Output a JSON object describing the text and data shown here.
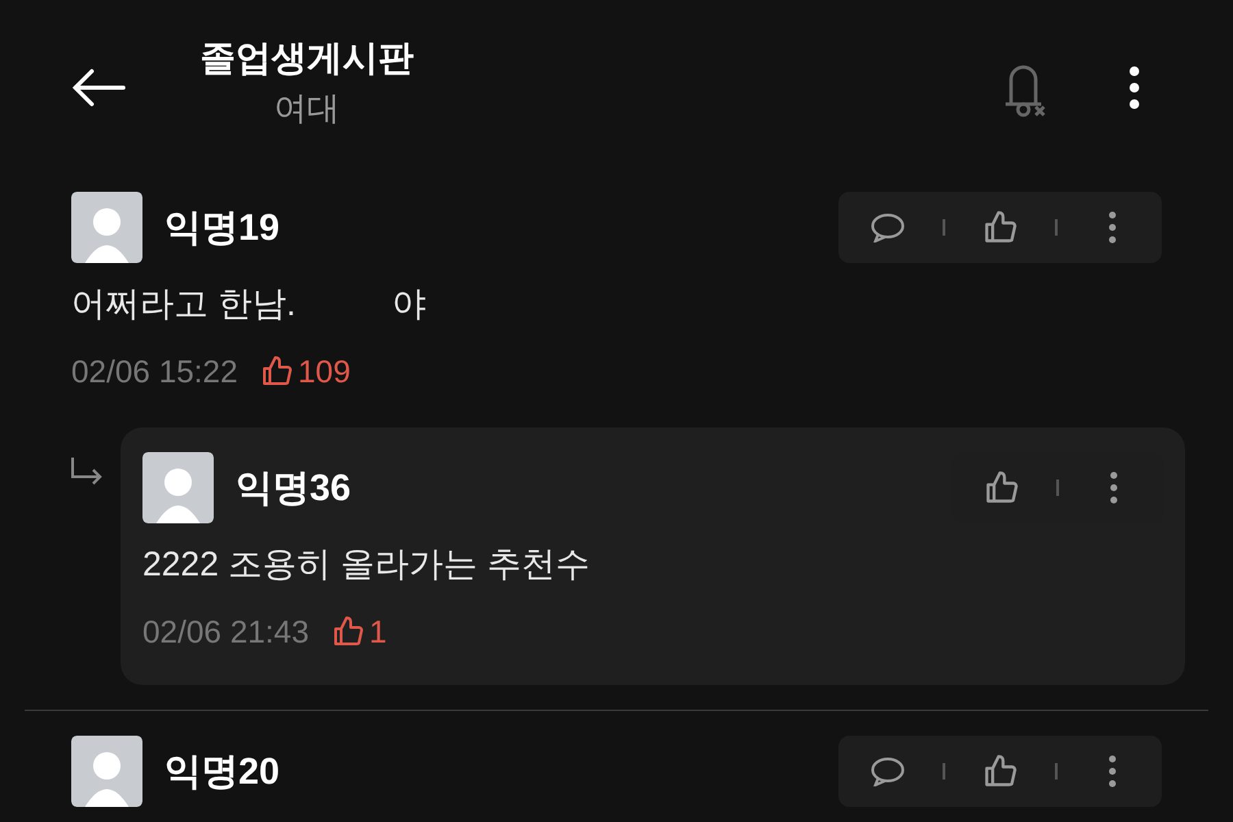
{
  "header": {
    "title": "졸업생게시판",
    "subtitle": "여대"
  },
  "comments": [
    {
      "kind": "comment",
      "author": "익명19",
      "body": [
        "어쩌라고 한남.",
        "야"
      ],
      "time": "02/06 15:22",
      "likes": "109",
      "actions": [
        {
          "kind": "reply"
        },
        {
          "kind": "like"
        },
        {
          "kind": "more"
        }
      ]
    },
    {
      "kind": "reply",
      "author": "익명36",
      "body": [
        "2222 조용히 올라가는 추천수"
      ],
      "time": "02/06 21:43",
      "likes": "1",
      "actions": [
        {
          "kind": "like"
        },
        {
          "kind": "more"
        }
      ]
    },
    {
      "kind": "comment",
      "author": "익명20",
      "actions": [
        {
          "kind": "reply"
        },
        {
          "kind": "like"
        },
        {
          "kind": "more"
        }
      ]
    }
  ]
}
